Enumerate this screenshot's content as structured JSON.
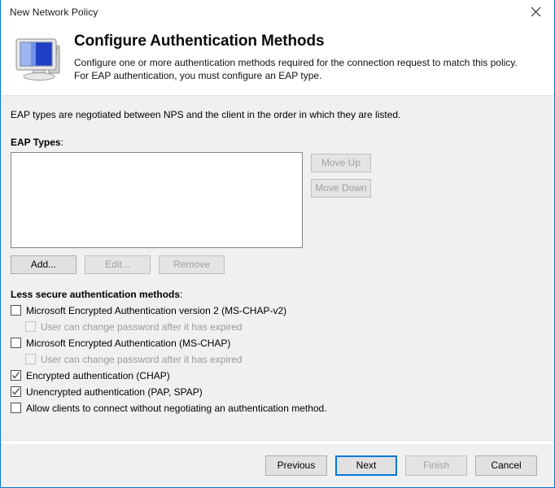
{
  "window": {
    "title": "New Network Policy",
    "close_icon": "close-icon",
    "accent_color": "#0078d7",
    "body_background": "#f0f0f0"
  },
  "header": {
    "icon": "computer-monitor-icon",
    "title": "Configure Authentication Methods",
    "description": "Configure one or more authentication methods required for the connection request to match this policy. For EAP authentication, you must configure an EAP type."
  },
  "main": {
    "intro_text": "EAP types are negotiated between NPS and the client in the order in which they are listed.",
    "eap_types_label": "EAP Types",
    "eap_types_label_colon": ":",
    "eap_list_items": [],
    "side_buttons": [
      {
        "label": "Move Up",
        "enabled": false
      },
      {
        "label": "Move Down",
        "enabled": false
      }
    ],
    "list_buttons": [
      {
        "label": "Add...",
        "enabled": true
      },
      {
        "label": "Edit...",
        "enabled": false
      },
      {
        "label": "Remove",
        "enabled": false
      }
    ],
    "less_secure_label": "Less secure authentication methods",
    "less_secure_label_colon": ":",
    "checkboxes": [
      {
        "label": "Microsoft Encrypted Authentication version 2 (MS-CHAP-v2)",
        "checked": false,
        "enabled": true,
        "indent": false
      },
      {
        "label": "User can change password after it has expired",
        "checked": false,
        "enabled": false,
        "indent": true
      },
      {
        "label": "Microsoft Encrypted Authentication (MS-CHAP)",
        "checked": false,
        "enabled": true,
        "indent": false
      },
      {
        "label": "User can change password after it has expired",
        "checked": false,
        "enabled": false,
        "indent": true
      },
      {
        "label": "Encrypted authentication (CHAP)",
        "checked": true,
        "enabled": true,
        "indent": false
      },
      {
        "label": "Unencrypted authentication (PAP, SPAP)",
        "checked": true,
        "enabled": true,
        "indent": false
      },
      {
        "label": "Allow clients to connect without negotiating an authentication method.",
        "checked": false,
        "enabled": true,
        "indent": false
      }
    ]
  },
  "footer": {
    "buttons": [
      {
        "label": "Previous",
        "enabled": true,
        "default": false
      },
      {
        "label": "Next",
        "enabled": true,
        "default": true
      },
      {
        "label": "Finish",
        "enabled": false,
        "default": false
      },
      {
        "label": "Cancel",
        "enabled": true,
        "default": false
      }
    ]
  }
}
